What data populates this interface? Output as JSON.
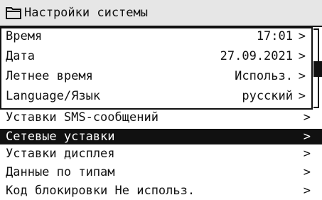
{
  "header": {
    "title": "Настройки системы",
    "icon": "folder-icon"
  },
  "settings": [
    {
      "label": "Время",
      "value": "17:01",
      "arrow": ">"
    },
    {
      "label": "Дата",
      "value": "27.09.2021",
      "arrow": ">"
    },
    {
      "label": "Летнее время",
      "value": "Использ.",
      "arrow": ">"
    },
    {
      "label": "Language/Язык",
      "value": "русский",
      "arrow": ">"
    }
  ],
  "menu": [
    {
      "label": "Уставки SMS-сообщений",
      "arrow": ">"
    },
    {
      "label": "Сетевые уставки",
      "arrow": ">",
      "selected": true
    },
    {
      "label": "Уставки дисплея",
      "arrow": ">"
    },
    {
      "label": "Данные по типам",
      "arrow": ">"
    },
    {
      "label": "Код блокировки Не использ.",
      "arrow": ">"
    }
  ],
  "scrollbar": {
    "position": 0.35
  },
  "colors": {
    "foreground": "#111111",
    "background": "#ffffff",
    "header_bg": "#e6e6e6"
  }
}
